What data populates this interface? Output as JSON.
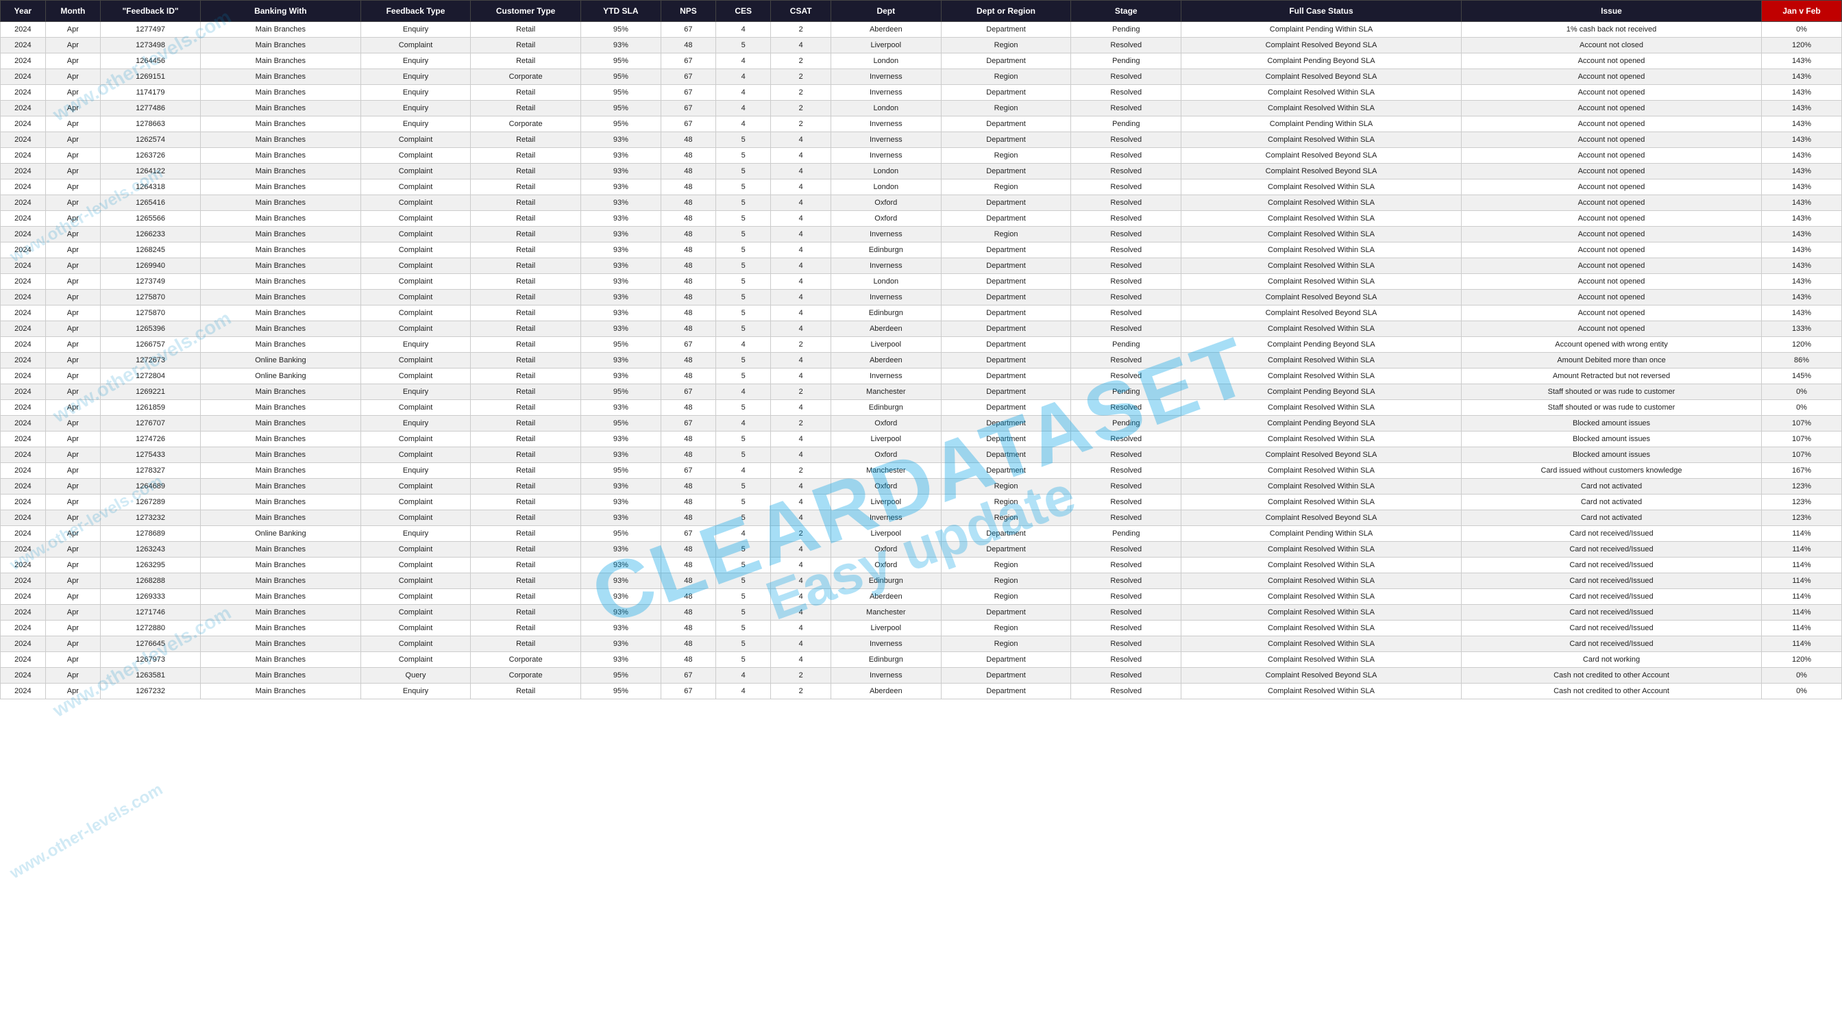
{
  "columns": [
    {
      "id": "year",
      "label": "Year",
      "class": "col-year"
    },
    {
      "id": "month",
      "label": "Month",
      "class": "col-month"
    },
    {
      "id": "feedback_id",
      "label": "\"Feedback ID\"",
      "class": "col-feedback-id"
    },
    {
      "id": "banking_with",
      "label": "Banking With",
      "class": "col-banking-with"
    },
    {
      "id": "feedback_type",
      "label": "Feedback Type",
      "class": "col-feedback-type"
    },
    {
      "id": "customer_type",
      "label": "Customer Type",
      "class": "col-customer-type"
    },
    {
      "id": "ytd_sla",
      "label": "YTD SLA",
      "class": "col-ytd-sla"
    },
    {
      "id": "nps",
      "label": "NPS",
      "class": "col-nps"
    },
    {
      "id": "ces",
      "label": "CES",
      "class": "col-ces"
    },
    {
      "id": "csat",
      "label": "CSAT",
      "class": "col-csat"
    },
    {
      "id": "dept",
      "label": "Dept",
      "class": "col-dept"
    },
    {
      "id": "dept_region",
      "label": "Dept or Region",
      "class": "col-dept-region"
    },
    {
      "id": "stage",
      "label": "Stage",
      "class": "col-stage"
    },
    {
      "id": "full_case_status",
      "label": "Full Case Status",
      "class": "col-full-case-status"
    },
    {
      "id": "issue",
      "label": "Issue",
      "class": "col-issue"
    },
    {
      "id": "jan_feb",
      "label": "Jan v Feb",
      "class": "col-jan-feb red-header"
    }
  ],
  "rows": [
    [
      "2024",
      "Apr",
      "1277497",
      "Main Branches",
      "Enquiry",
      "Retail",
      "95%",
      "67",
      "4",
      "2",
      "Aberdeen",
      "Department",
      "Pending",
      "Complaint Pending Within SLA",
      "1% cash back not received",
      "0%"
    ],
    [
      "2024",
      "Apr",
      "1273498",
      "Main Branches",
      "Complaint",
      "Retail",
      "93%",
      "48",
      "5",
      "4",
      "Liverpool",
      "Region",
      "Resolved",
      "Complaint Resolved Beyond SLA",
      "Account not closed",
      "120%"
    ],
    [
      "2024",
      "Apr",
      "1264456",
      "Main Branches",
      "Enquiry",
      "Retail",
      "95%",
      "67",
      "4",
      "2",
      "London",
      "Department",
      "Pending",
      "Complaint Pending Beyond SLA",
      "Account not opened",
      "143%"
    ],
    [
      "2024",
      "Apr",
      "1269151",
      "Main Branches",
      "Enquiry",
      "Corporate",
      "95%",
      "67",
      "4",
      "2",
      "Inverness",
      "Region",
      "Resolved",
      "Complaint Resolved Beyond SLA",
      "Account not opened",
      "143%"
    ],
    [
      "2024",
      "Apr",
      "1174179",
      "Main Branches",
      "Enquiry",
      "Retail",
      "95%",
      "67",
      "4",
      "2",
      "Inverness",
      "Department",
      "Resolved",
      "Complaint Resolved Within SLA",
      "Account not opened",
      "143%"
    ],
    [
      "2024",
      "Apr",
      "1277486",
      "Main Branches",
      "Enquiry",
      "Retail",
      "95%",
      "67",
      "4",
      "2",
      "London",
      "Region",
      "Resolved",
      "Complaint Resolved Within SLA",
      "Account not opened",
      "143%"
    ],
    [
      "2024",
      "Apr",
      "1278663",
      "Main Branches",
      "Enquiry",
      "Corporate",
      "95%",
      "67",
      "4",
      "2",
      "Inverness",
      "Department",
      "Pending",
      "Complaint Pending Within SLA",
      "Account not opened",
      "143%"
    ],
    [
      "2024",
      "Apr",
      "1262574",
      "Main Branches",
      "Complaint",
      "Retail",
      "93%",
      "48",
      "5",
      "4",
      "Inverness",
      "Department",
      "Resolved",
      "Complaint Resolved Within SLA",
      "Account not opened",
      "143%"
    ],
    [
      "2024",
      "Apr",
      "1263726",
      "Main Branches",
      "Complaint",
      "Retail",
      "93%",
      "48",
      "5",
      "4",
      "Inverness",
      "Region",
      "Resolved",
      "Complaint Resolved Beyond SLA",
      "Account not opened",
      "143%"
    ],
    [
      "2024",
      "Apr",
      "1264122",
      "Main Branches",
      "Complaint",
      "Retail",
      "93%",
      "48",
      "5",
      "4",
      "London",
      "Department",
      "Resolved",
      "Complaint Resolved Beyond SLA",
      "Account not opened",
      "143%"
    ],
    [
      "2024",
      "Apr",
      "1264318",
      "Main Branches",
      "Complaint",
      "Retail",
      "93%",
      "48",
      "5",
      "4",
      "London",
      "Region",
      "Resolved",
      "Complaint Resolved Within SLA",
      "Account not opened",
      "143%"
    ],
    [
      "2024",
      "Apr",
      "1265416",
      "Main Branches",
      "Complaint",
      "Retail",
      "93%",
      "48",
      "5",
      "4",
      "Oxford",
      "Department",
      "Resolved",
      "Complaint Resolved Within SLA",
      "Account not opened",
      "143%"
    ],
    [
      "2024",
      "Apr",
      "1265566",
      "Main Branches",
      "Complaint",
      "Retail",
      "93%",
      "48",
      "5",
      "4",
      "Oxford",
      "Department",
      "Resolved",
      "Complaint Resolved Within SLA",
      "Account not opened",
      "143%"
    ],
    [
      "2024",
      "Apr",
      "1266233",
      "Main Branches",
      "Complaint",
      "Retail",
      "93%",
      "48",
      "5",
      "4",
      "Inverness",
      "Region",
      "Resolved",
      "Complaint Resolved Within SLA",
      "Account not opened",
      "143%"
    ],
    [
      "2024",
      "Apr",
      "1268245",
      "Main Branches",
      "Complaint",
      "Retail",
      "93%",
      "48",
      "5",
      "4",
      "Edinburgn",
      "Department",
      "Resolved",
      "Complaint Resolved Within SLA",
      "Account not opened",
      "143%"
    ],
    [
      "2024",
      "Apr",
      "1269940",
      "Main Branches",
      "Complaint",
      "Retail",
      "93%",
      "48",
      "5",
      "4",
      "Inverness",
      "Department",
      "Resolved",
      "Complaint Resolved Within SLA",
      "Account not opened",
      "143%"
    ],
    [
      "2024",
      "Apr",
      "1273749",
      "Main Branches",
      "Complaint",
      "Retail",
      "93%",
      "48",
      "5",
      "4",
      "London",
      "Department",
      "Resolved",
      "Complaint Resolved Within SLA",
      "Account not opened",
      "143%"
    ],
    [
      "2024",
      "Apr",
      "1275870",
      "Main Branches",
      "Complaint",
      "Retail",
      "93%",
      "48",
      "5",
      "4",
      "Inverness",
      "Department",
      "Resolved",
      "Complaint Resolved Beyond SLA",
      "Account not opened",
      "143%"
    ],
    [
      "2024",
      "Apr",
      "1275870",
      "Main Branches",
      "Complaint",
      "Retail",
      "93%",
      "48",
      "5",
      "4",
      "Edinburgn",
      "Department",
      "Resolved",
      "Complaint Resolved Beyond SLA",
      "Account not opened",
      "143%"
    ],
    [
      "2024",
      "Apr",
      "1265396",
      "Main Branches",
      "Complaint",
      "Retail",
      "93%",
      "48",
      "5",
      "4",
      "Aberdeen",
      "Department",
      "Resolved",
      "Complaint Resolved Within SLA",
      "Account not opened",
      "133%"
    ],
    [
      "2024",
      "Apr",
      "1266757",
      "Main Branches",
      "Enquiry",
      "Retail",
      "95%",
      "67",
      "4",
      "2",
      "Liverpool",
      "Department",
      "Pending",
      "Complaint Pending Beyond SLA",
      "Account opened with wrong entity",
      "120%"
    ],
    [
      "2024",
      "Apr",
      "1272673",
      "Online Banking",
      "Complaint",
      "Retail",
      "93%",
      "48",
      "5",
      "4",
      "Aberdeen",
      "Department",
      "Resolved",
      "Complaint Resolved Within SLA",
      "Amount Debited more than once",
      "86%"
    ],
    [
      "2024",
      "Apr",
      "1272804",
      "Online Banking",
      "Complaint",
      "Retail",
      "93%",
      "48",
      "5",
      "4",
      "Inverness",
      "Department",
      "Resolved",
      "Complaint Resolved Within SLA",
      "Amount Retracted but not reversed",
      "145%"
    ],
    [
      "2024",
      "Apr",
      "1269221",
      "Main Branches",
      "Enquiry",
      "Retail",
      "95%",
      "67",
      "4",
      "2",
      "Manchester",
      "Department",
      "Pending",
      "Complaint Pending Beyond SLA",
      "Staff shouted or was rude to customer",
      "0%"
    ],
    [
      "2024",
      "Apr",
      "1261859",
      "Main Branches",
      "Complaint",
      "Retail",
      "93%",
      "48",
      "5",
      "4",
      "Edinburgn",
      "Department",
      "Resolved",
      "Complaint Resolved Within SLA",
      "Staff shouted or was rude to customer",
      "0%"
    ],
    [
      "2024",
      "Apr",
      "1276707",
      "Main Branches",
      "Enquiry",
      "Retail",
      "95%",
      "67",
      "4",
      "2",
      "Oxford",
      "Department",
      "Pending",
      "Complaint Pending Beyond SLA",
      "Blocked amount issues",
      "107%"
    ],
    [
      "2024",
      "Apr",
      "1274726",
      "Main Branches",
      "Complaint",
      "Retail",
      "93%",
      "48",
      "5",
      "4",
      "Liverpool",
      "Department",
      "Resolved",
      "Complaint Resolved Within SLA",
      "Blocked amount issues",
      "107%"
    ],
    [
      "2024",
      "Apr",
      "1275433",
      "Main Branches",
      "Complaint",
      "Retail",
      "93%",
      "48",
      "5",
      "4",
      "Oxford",
      "Department",
      "Resolved",
      "Complaint Resolved Beyond SLA",
      "Blocked amount issues",
      "107%"
    ],
    [
      "2024",
      "Apr",
      "1278327",
      "Main Branches",
      "Enquiry",
      "Retail",
      "95%",
      "67",
      "4",
      "2",
      "Manchester",
      "Department",
      "Resolved",
      "Complaint Resolved Within SLA",
      "Card issued without customers knowledge",
      "167%"
    ],
    [
      "2024",
      "Apr",
      "1264689",
      "Main Branches",
      "Complaint",
      "Retail",
      "93%",
      "48",
      "5",
      "4",
      "Oxford",
      "Region",
      "Resolved",
      "Complaint Resolved Within SLA",
      "Card not activated",
      "123%"
    ],
    [
      "2024",
      "Apr",
      "1267289",
      "Main Branches",
      "Complaint",
      "Retail",
      "93%",
      "48",
      "5",
      "4",
      "Liverpool",
      "Region",
      "Resolved",
      "Complaint Resolved Within SLA",
      "Card not activated",
      "123%"
    ],
    [
      "2024",
      "Apr",
      "1273232",
      "Main Branches",
      "Complaint",
      "Retail",
      "93%",
      "48",
      "5",
      "4",
      "Inverness",
      "Region",
      "Resolved",
      "Complaint Resolved Beyond SLA",
      "Card not activated",
      "123%"
    ],
    [
      "2024",
      "Apr",
      "1278689",
      "Online Banking",
      "Enquiry",
      "Retail",
      "95%",
      "67",
      "4",
      "2",
      "Liverpool",
      "Department",
      "Pending",
      "Complaint Pending Within SLA",
      "Card not received/Issued",
      "114%"
    ],
    [
      "2024",
      "Apr",
      "1263243",
      "Main Branches",
      "Complaint",
      "Retail",
      "93%",
      "48",
      "5",
      "4",
      "Oxford",
      "Department",
      "Resolved",
      "Complaint Resolved Within SLA",
      "Card not received/Issued",
      "114%"
    ],
    [
      "2024",
      "Apr",
      "1263295",
      "Main Branches",
      "Complaint",
      "Retail",
      "93%",
      "48",
      "5",
      "4",
      "Oxford",
      "Region",
      "Resolved",
      "Complaint Resolved Within SLA",
      "Card not received/Issued",
      "114%"
    ],
    [
      "2024",
      "Apr",
      "1268288",
      "Main Branches",
      "Complaint",
      "Retail",
      "93%",
      "48",
      "5",
      "4",
      "Edinburgn",
      "Region",
      "Resolved",
      "Complaint Resolved Within SLA",
      "Card not received/Issued",
      "114%"
    ],
    [
      "2024",
      "Apr",
      "1269333",
      "Main Branches",
      "Complaint",
      "Retail",
      "93%",
      "48",
      "5",
      "4",
      "Aberdeen",
      "Region",
      "Resolved",
      "Complaint Resolved Within SLA",
      "Card not received/Issued",
      "114%"
    ],
    [
      "2024",
      "Apr",
      "1271746",
      "Main Branches",
      "Complaint",
      "Retail",
      "93%",
      "48",
      "5",
      "4",
      "Manchester",
      "Department",
      "Resolved",
      "Complaint Resolved Within SLA",
      "Card not received/Issued",
      "114%"
    ],
    [
      "2024",
      "Apr",
      "1272880",
      "Main Branches",
      "Complaint",
      "Retail",
      "93%",
      "48",
      "5",
      "4",
      "Liverpool",
      "Region",
      "Resolved",
      "Complaint Resolved Within SLA",
      "Card not received/Issued",
      "114%"
    ],
    [
      "2024",
      "Apr",
      "1276645",
      "Main Branches",
      "Complaint",
      "Retail",
      "93%",
      "48",
      "5",
      "4",
      "Inverness",
      "Region",
      "Resolved",
      "Complaint Resolved Within SLA",
      "Card not received/Issued",
      "114%"
    ],
    [
      "2024",
      "Apr",
      "1267973",
      "Main Branches",
      "Complaint",
      "Corporate",
      "93%",
      "48",
      "5",
      "4",
      "Edinburgn",
      "Department",
      "Resolved",
      "Complaint Resolved Within SLA",
      "Card not working",
      "120%"
    ],
    [
      "2024",
      "Apr",
      "1263581",
      "Main Branches",
      "Query",
      "Corporate",
      "95%",
      "67",
      "4",
      "2",
      "Inverness",
      "Department",
      "Resolved",
      "Complaint Resolved Beyond SLA",
      "Cash not credited to other Account",
      "0%"
    ],
    [
      "2024",
      "Apr",
      "1267232",
      "Main Branches",
      "Enquiry",
      "Retail",
      "95%",
      "67",
      "4",
      "2",
      "Aberdeen",
      "Department",
      "Resolved",
      "Complaint Resolved Within SLA",
      "Cash not credited to other Account",
      "0%"
    ]
  ],
  "watermark": {
    "line1": "ClearDataset",
    "line2": "Easy update"
  }
}
